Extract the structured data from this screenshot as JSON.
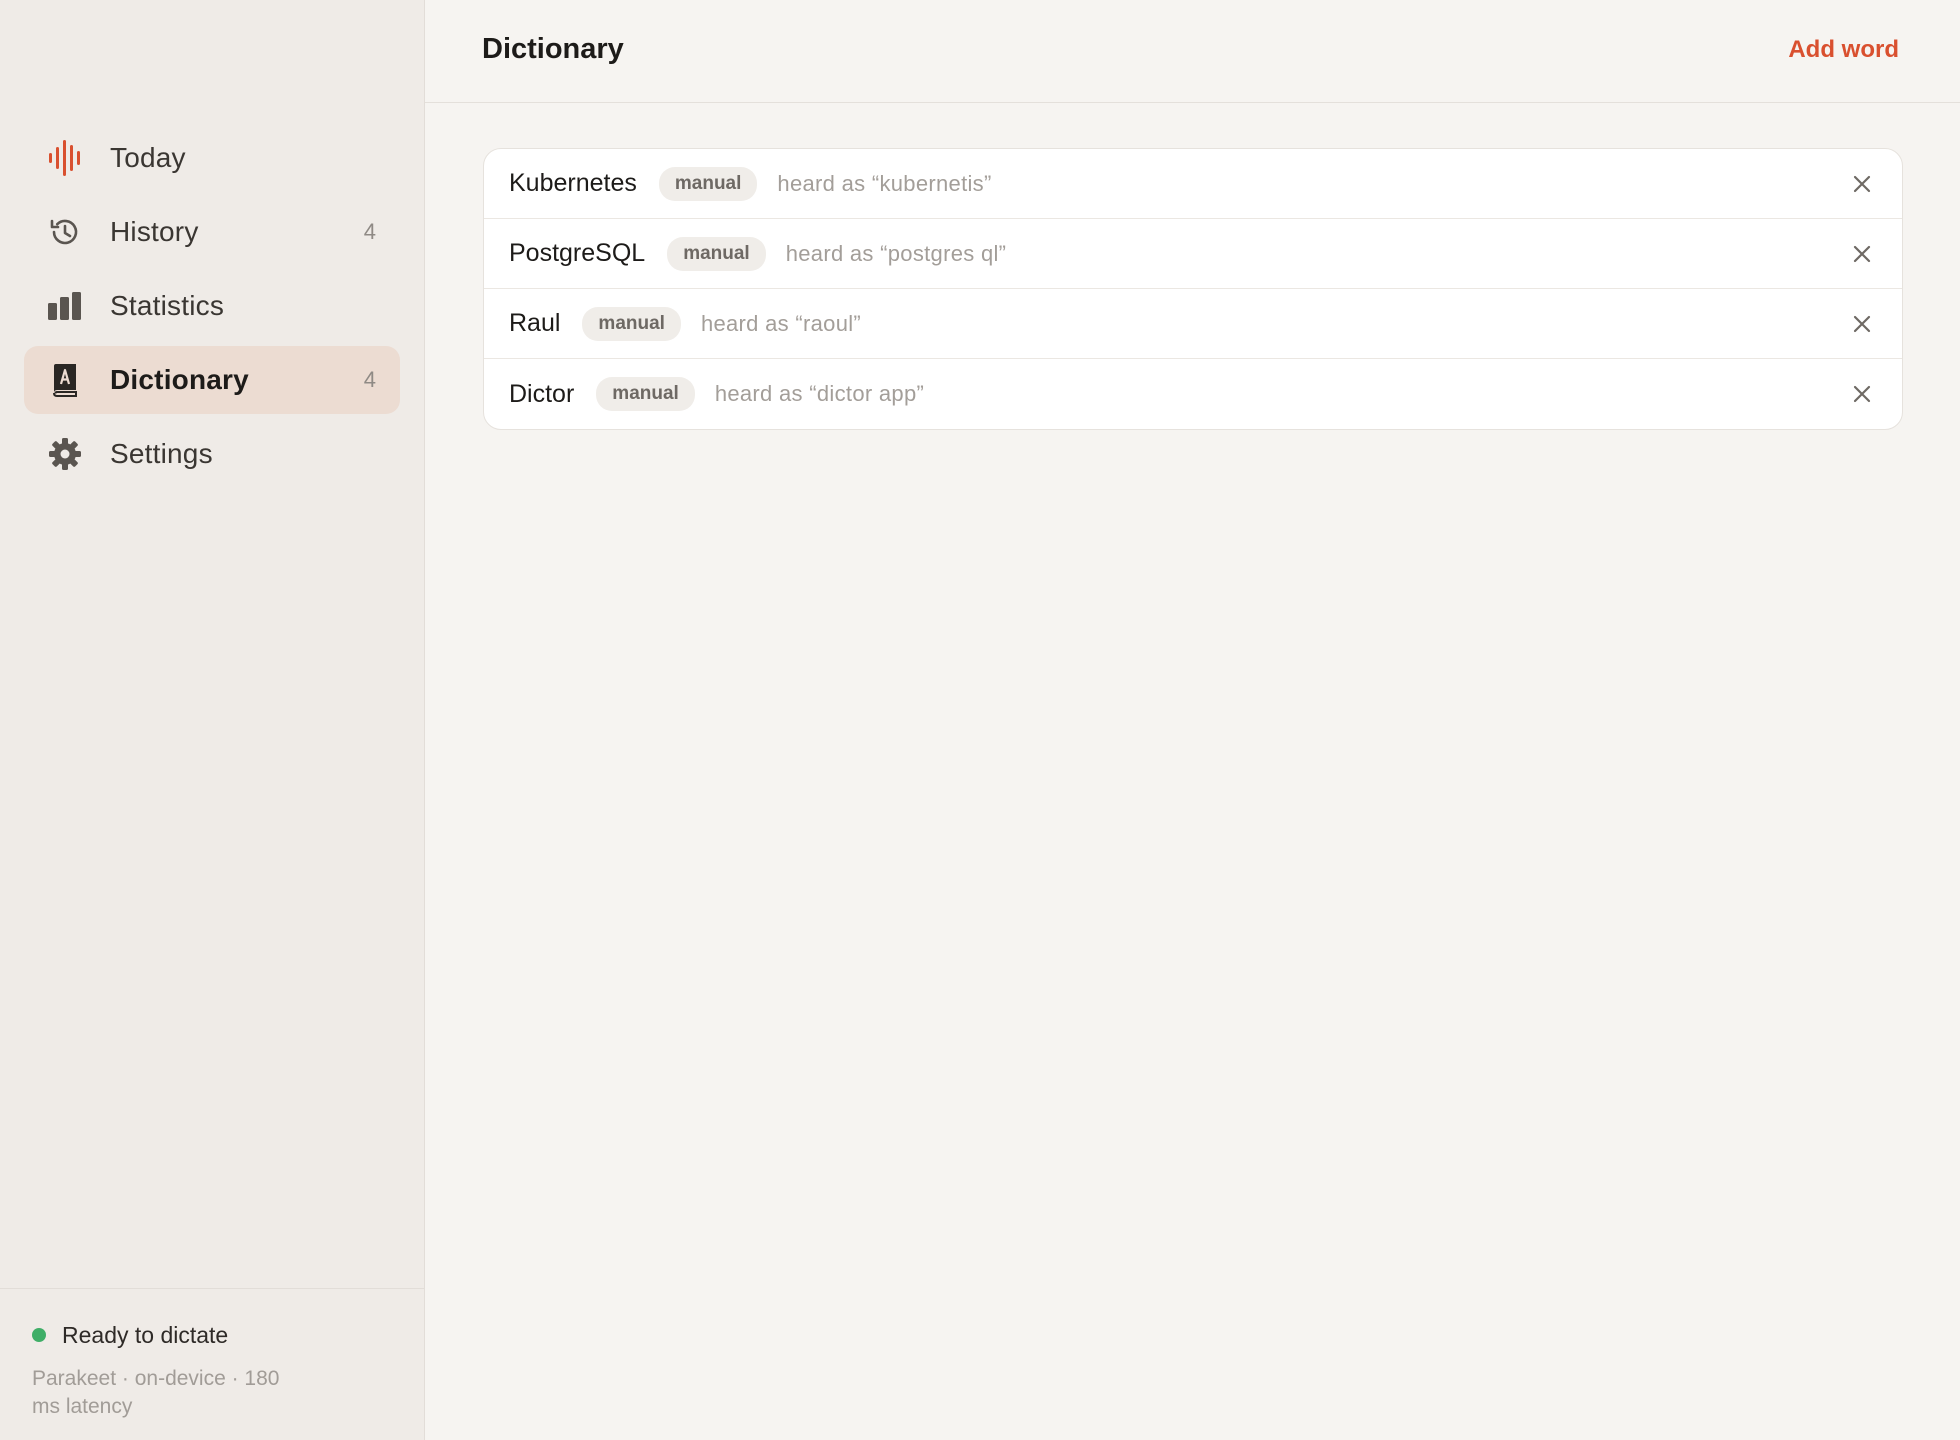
{
  "sidebar": {
    "items": [
      {
        "label": "Today",
        "count": "",
        "icon": "waveform-icon",
        "active": false
      },
      {
        "label": "History",
        "count": "4",
        "icon": "history-icon",
        "active": false
      },
      {
        "label": "Statistics",
        "count": "",
        "icon": "bar-chart-icon",
        "active": false
      },
      {
        "label": "Dictionary",
        "count": "4",
        "icon": "dictionary-book-icon",
        "active": true
      },
      {
        "label": "Settings",
        "count": "",
        "icon": "gear-icon",
        "active": false
      }
    ],
    "footer": {
      "status": "Ready to dictate",
      "engine": "Parakeet · on-device · 180 ms latency"
    }
  },
  "header": {
    "title": "Dictionary",
    "add_label": "Add word"
  },
  "words": [
    {
      "word": "Kubernetes",
      "badge": "manual",
      "heard": "heard as “kubernetis”"
    },
    {
      "word": "PostgreSQL",
      "badge": "manual",
      "heard": "heard as “postgres ql”"
    },
    {
      "word": "Raul",
      "badge": "manual",
      "heard": "heard as “raoul”"
    },
    {
      "word": "Dictor",
      "badge": "manual",
      "heard": "heard as “dictor app”"
    }
  ],
  "colors": {
    "accent": "#d9502f",
    "active_bg": "#ecdcd2",
    "status_green": "#3fae67",
    "sidebar_bg": "#efebe7",
    "main_bg": "#f6f4f1"
  }
}
